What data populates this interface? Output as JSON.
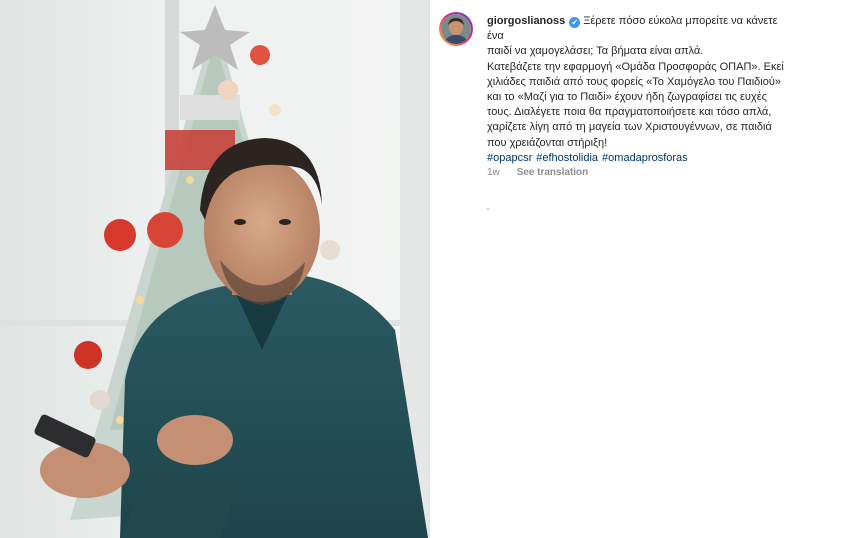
{
  "post": {
    "username": "giorgoslianoss",
    "verified_icon": "✔",
    "caption_lines": [
      "Ξέρετε πόσο εύκολα μπορείτε να κάνετε ένα",
      "παιδί να χαμογελάσει; Τα βήματα είναι απλά.",
      "Κατεβάζετε την εφαρμογή «Ομάδα Προσφοράς ΟΠΑΠ». Εκεί",
      "χιλιάδες παιδιά από τους φορείς «Το Χαμόγελο του Παιδιού»",
      "και το «Μαζί για το Παιδί» έχουν ήδη ζωγραφίσει τις ευχές",
      "τους. Διαλέγετε ποια θα πραγματοποιήσετε και τόσο απλά,",
      "χαρίζετε λίγη από τη μαγεία των Χριστουγέννων, σε παιδιά",
      "που χρειάζονται στήριξη!"
    ],
    "hashtags": [
      "#opapcsr",
      "#efhostolidia",
      "#omadaprosforas"
    ],
    "time_ago": "1w",
    "see_translation": "See translation"
  },
  "icons": {
    "avatar": "profile-avatar-icon",
    "verified": "verified-badge-icon"
  },
  "colors": {
    "link": "#00376b",
    "muted": "#8e8e8e",
    "verified": "#3897f0",
    "text": "#262626"
  }
}
